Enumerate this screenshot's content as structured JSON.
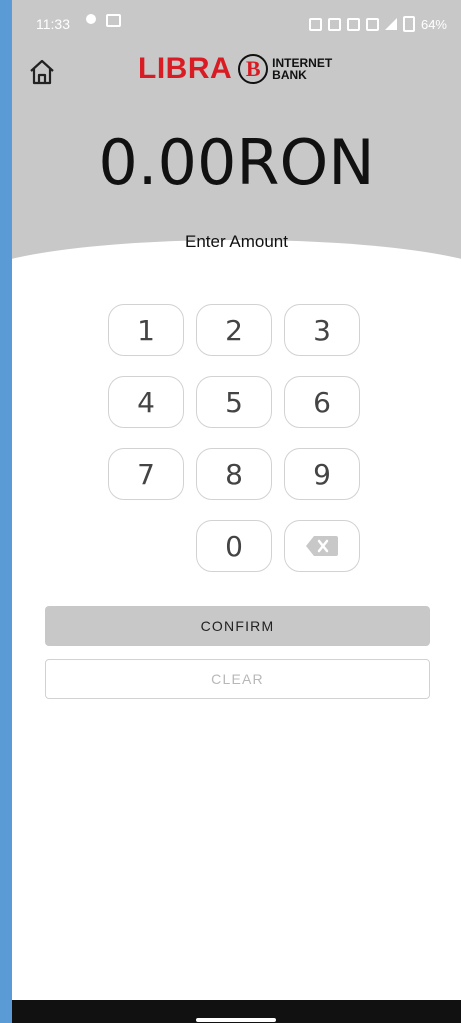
{
  "status_bar": {
    "time": "11:33",
    "battery_percent": "64%",
    "icons": {
      "chat": "chat-icon",
      "image": "image-icon",
      "signal": "signal-icon",
      "battery": "battery-icon"
    }
  },
  "header": {
    "logo_text": "LIBRA",
    "logo_letter": "B",
    "logo_subtext_line1": "INTERNET",
    "logo_subtext_line2": "BANK",
    "amount": "0.00RON",
    "instruction": "Enter Amount"
  },
  "keypad": {
    "keys": [
      "1",
      "2",
      "3",
      "4",
      "5",
      "6",
      "7",
      "8",
      "9",
      "0"
    ],
    "backspace_icon": "backspace-icon"
  },
  "actions": {
    "confirm_label": "CONFIRM",
    "clear_label": "CLEAR"
  }
}
